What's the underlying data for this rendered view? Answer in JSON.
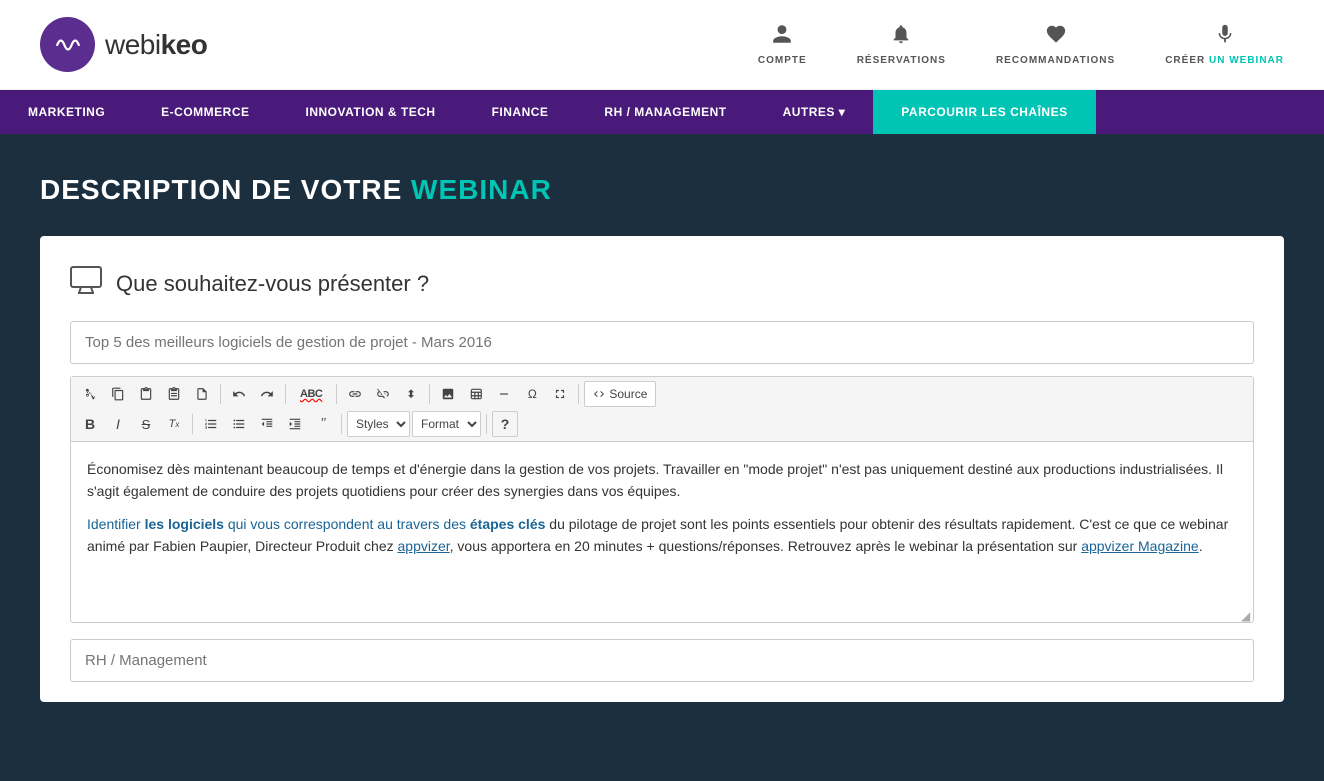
{
  "header": {
    "logo_text_normal": "webi",
    "logo_text_bold": "keo",
    "nav_icons": [
      {
        "id": "compte",
        "label": "COMPTE",
        "icon": "person"
      },
      {
        "id": "reservations",
        "label": "RÉSERVATIONS",
        "icon": "bell"
      },
      {
        "id": "recommandations",
        "label": "RECOMMANDATIONS",
        "icon": "heart"
      },
      {
        "id": "creer",
        "label_normal": "CRÉER ",
        "label_highlight": "UN WEBINAR",
        "icon": "mic"
      }
    ]
  },
  "navbar": {
    "items": [
      {
        "id": "marketing",
        "label": "MARKETING",
        "active": false
      },
      {
        "id": "ecommerce",
        "label": "E-COMMERCE",
        "active": false
      },
      {
        "id": "innovation",
        "label": "INNOVATION & TECH",
        "active": false
      },
      {
        "id": "finance",
        "label": "FINANCE",
        "active": false
      },
      {
        "id": "rh",
        "label": "RH / MANAGEMENT",
        "active": false
      },
      {
        "id": "autres",
        "label": "AUTRES ▾",
        "active": false
      },
      {
        "id": "parcourir",
        "label": "PARCOURIR LES CHAÎNES",
        "active": true
      }
    ]
  },
  "page": {
    "title_normal": "DESCRIPTION DE VOTRE ",
    "title_highlight": "WEBINAR"
  },
  "form": {
    "question": "Que souhaitez-vous présenter ?",
    "title_placeholder": "Top 5 des meilleurs logiciels de gestion de projet - Mars 2016",
    "category_placeholder": "RH / Management",
    "source_label": "Source",
    "format_label": "Format",
    "styles_label": "Styles",
    "editor_content_1": "Économisez dès maintenant beaucoup de temps et d'énergie dans la gestion de vos projets. Travailler en \"mode projet\" n'est pas uniquement destiné aux productions industrialisées. Il s'agit également de conduire des projets quotidiens pour créer des synergies dans vos équipes.",
    "editor_content_2_start": "Identifier ",
    "editor_content_2_bold1": "les logiciels",
    "editor_content_2_mid": " qui vous correspondent au travers des ",
    "editor_content_2_bold2": "étapes clés",
    "editor_content_2_end": " du pilotage de projet sont les points essentiels pour obtenir des résultats rapidement. C'est ce que ce webinar animé par Fabien Paupier, Directeur Produit chez ",
    "editor_link1": "appvizer",
    "editor_content_3": ", vous apportera en 20 minutes + questions/réponses. Retrouvez après le webinar la présentation sur ",
    "editor_link2": "appvizer Magazine",
    "editor_content_4": ".",
    "toolbar": {
      "row1_btns": [
        "✂",
        "📋",
        "⬜",
        "⬜",
        "⬜",
        "↩",
        "↪",
        "ABC",
        "🔗",
        "🔗",
        "⚑",
        "🖼",
        "⊞",
        "≡",
        "Ω",
        "⤢"
      ],
      "row2_btns": [
        "B",
        "I",
        "S",
        "Tx",
        "|",
        "≡",
        "≡",
        "⊕",
        "⊖",
        "❝"
      ]
    }
  }
}
